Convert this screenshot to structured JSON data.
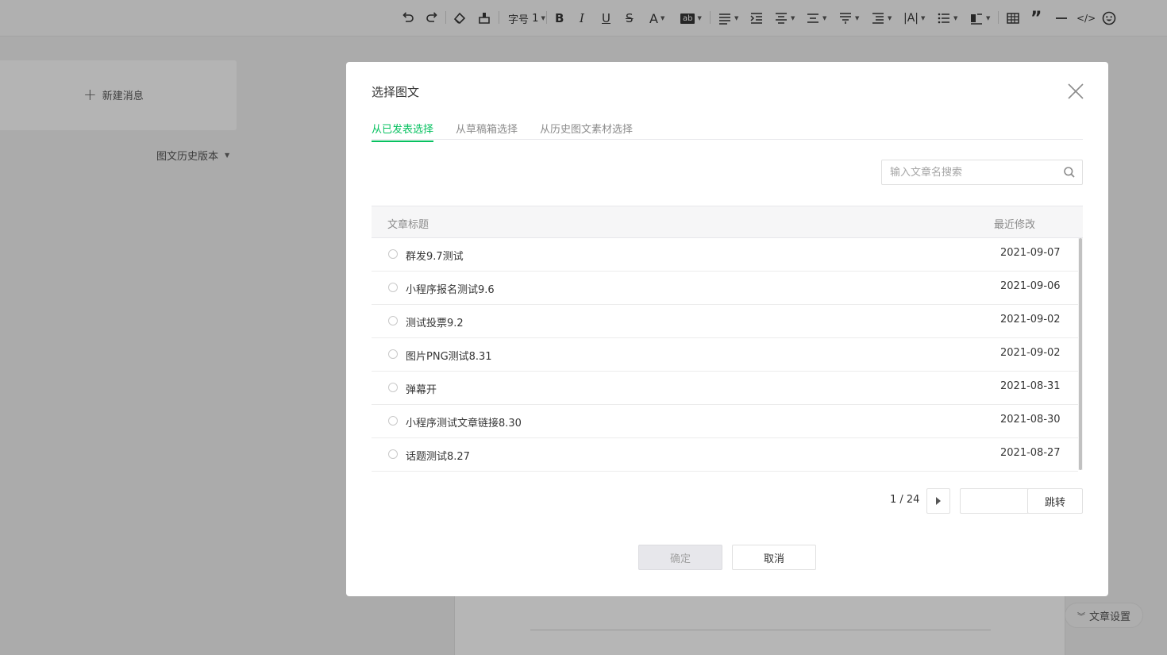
{
  "toolbar": {
    "font_size_label": "字号",
    "font_size_value": "1"
  },
  "sidebar": {
    "new_message_label": "新建消息",
    "history_label": "图文历史版本"
  },
  "article_settings_label": "文章设置",
  "dialog": {
    "title": "选择图文",
    "tabs": [
      {
        "label": "从已发表选择",
        "active": true
      },
      {
        "label": "从草稿箱选择",
        "active": false
      },
      {
        "label": "从历史图文素材选择",
        "active": false
      }
    ],
    "search": {
      "placeholder": "输入文章名搜索",
      "value": ""
    },
    "table": {
      "columns": [
        "文章标题",
        "最近修改"
      ],
      "rows": [
        {
          "title": "群发9.7测试",
          "date": "2021-09-07"
        },
        {
          "title": "小程序报名测试9.6",
          "date": "2021-09-06"
        },
        {
          "title": "测试投票9.2",
          "date": "2021-09-02"
        },
        {
          "title": "图片PNG测试8.31",
          "date": "2021-09-02"
        },
        {
          "title": "弹幕开",
          "date": "2021-08-31"
        },
        {
          "title": "小程序测试文章链接8.30",
          "date": "2021-08-30"
        },
        {
          "title": "话题测试8.27",
          "date": "2021-08-27"
        }
      ]
    },
    "pagination": {
      "text": "1 / 24",
      "jump_label": "跳转",
      "page_input_value": ""
    },
    "confirm_label": "确定",
    "cancel_label": "取消"
  },
  "colors": {
    "accent": "#07c160",
    "overlay": "rgba(0,0,0,0.28)"
  }
}
